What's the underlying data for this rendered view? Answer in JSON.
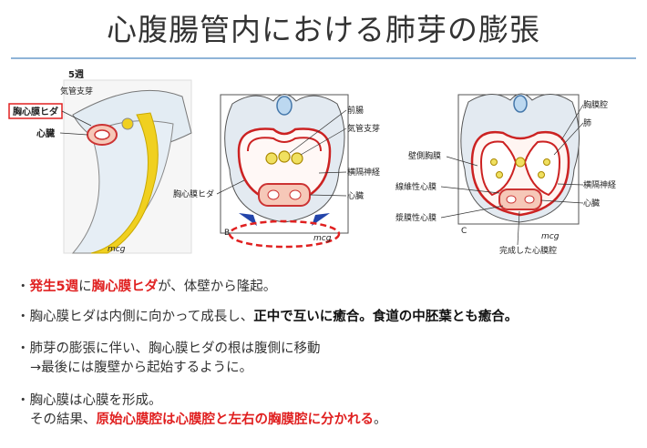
{
  "title": "心腹腸管内における肺芽の膨張",
  "figA": {
    "week": "5週",
    "bronchial": "気管支芽",
    "fold": "胸心膜ヒダ",
    "heart": "心臓",
    "sig": "mcg"
  },
  "figB": {
    "letter": "B",
    "foregut": "前腸",
    "bronchial": "気管支芽",
    "phrenic": "横隔神経",
    "fold": "胸心膜ヒダ",
    "heart": "心臓",
    "sig": "mcg"
  },
  "figC": {
    "letter": "C",
    "pleural": "胸膜腔",
    "lung": "肺",
    "parietal": "壁側胸膜",
    "phrenic": "横隔神経",
    "fibrous": "線維性心膜",
    "heart": "心臓",
    "serous": "漿膜性心膜",
    "completed": "完成した心膜腔",
    "sig": "mcg"
  },
  "bullets": {
    "b1": {
      "p1": "・",
      "p2": "発生5週",
      "p3": "に",
      "p4": "胸心膜ヒダ",
      "p5": "が、体壁から隆起。"
    },
    "b2": {
      "p1": "・胸心膜ヒダは内側に向かって成長し、",
      "p2": "正中で互いに癒合。食道の中胚葉とも癒合。"
    },
    "b3": {
      "line1": "・肺芽の膨張に伴い、胸心膜ヒダの根は腹側に移動",
      "line2": "→最後には腹壁から起始するように。"
    },
    "b4": {
      "line1": "・胸心膜は心膜を形成。",
      "p1": "その結果、",
      "p2": "原始心膜腔は心膜腔と左右の胸膜腔に分かれる",
      "p3": "。"
    }
  },
  "colors": {
    "accent": "#e02020",
    "rule": "#8fb4d8"
  }
}
